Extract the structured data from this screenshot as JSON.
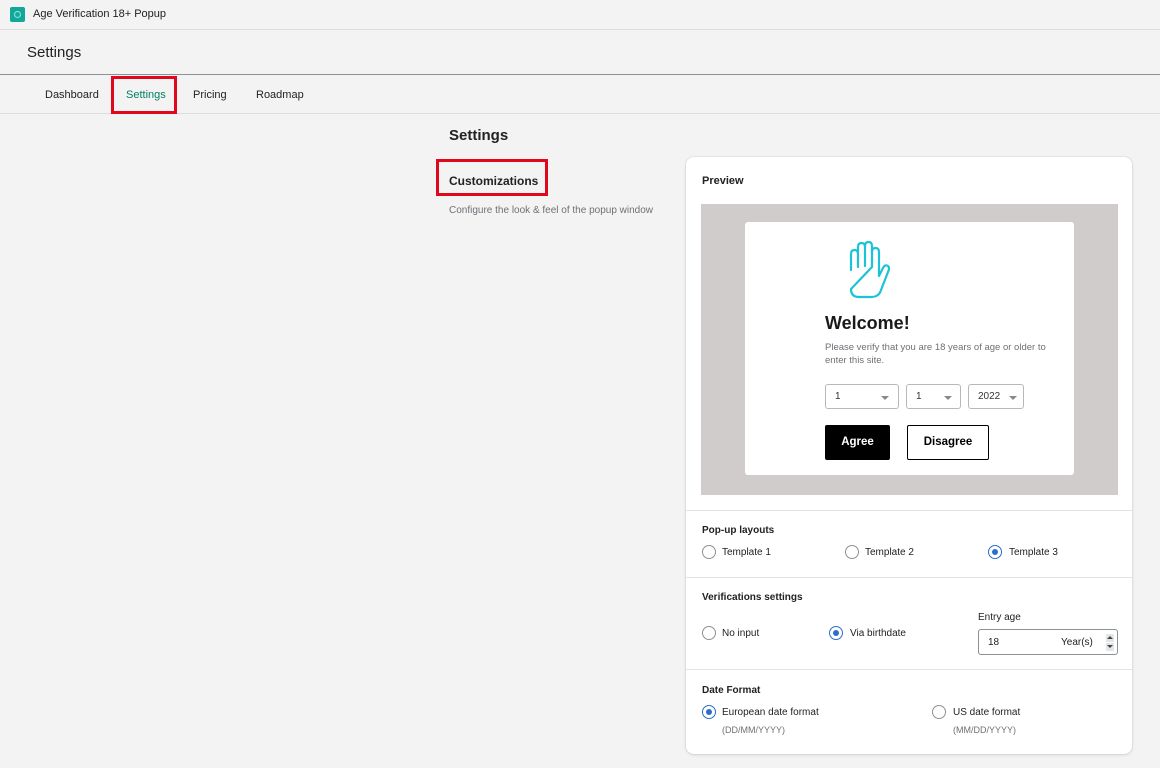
{
  "app": {
    "title": "Age Verification 18+ Popup",
    "icon": "app-logo-icon"
  },
  "header": {
    "title": "Settings"
  },
  "tabs": [
    {
      "label": "Dashboard",
      "active": false
    },
    {
      "label": "Settings",
      "active": true
    },
    {
      "label": "Pricing",
      "active": false
    },
    {
      "label": "Roadmap",
      "active": false
    }
  ],
  "section": {
    "heading": "Settings",
    "title": "Customizations",
    "description": "Configure the look & feel of the popup window"
  },
  "preview": {
    "title": "Preview",
    "popup": {
      "icon": "hand-stop-icon",
      "welcome": "Welcome!",
      "text": "Please verify that you are 18 years of age or older to enter this site.",
      "day": "1",
      "month": "1",
      "year": "2022",
      "agree_label": "Agree",
      "disagree_label": "Disagree"
    }
  },
  "layouts": {
    "title": "Pop-up layouts",
    "options": [
      {
        "label": "Template 1",
        "checked": false
      },
      {
        "label": "Template 2",
        "checked": false
      },
      {
        "label": "Template 3",
        "checked": true
      }
    ]
  },
  "verification": {
    "title": "Verifications settings",
    "options": [
      {
        "label": "No input",
        "checked": false
      },
      {
        "label": "Via birthdate",
        "checked": true
      }
    ],
    "entry_age_label": "Entry age",
    "entry_age_value": "18",
    "entry_age_suffix": "Year(s)"
  },
  "date_format": {
    "title": "Date Format",
    "options": [
      {
        "label": "European date format",
        "hint": "(DD/MM/YYYY)",
        "checked": true
      },
      {
        "label": "US date format",
        "hint": "(MM/DD/YYYY)",
        "checked": false
      }
    ]
  },
  "colors": {
    "accent": "#2c6ecb",
    "active_tab": "#008060",
    "highlight": "#e0081d",
    "preview_bg": "#d0cccb"
  }
}
